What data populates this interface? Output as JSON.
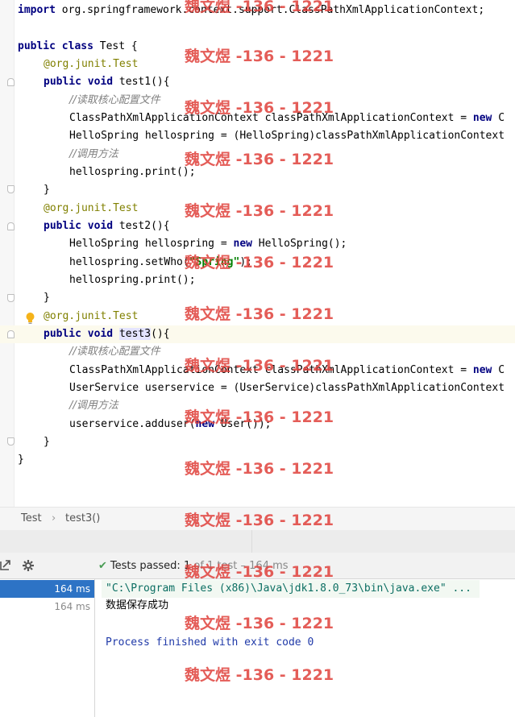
{
  "editor": {
    "lines": {
      "l0": [
        "import",
        " org.springframework.context.support.ClassPathXmlApplicationContext;"
      ],
      "l2": [
        "public",
        " ",
        "class",
        " Test {"
      ],
      "l3": "@org.junit.",
      "l3b": "Test",
      "l4": [
        "public",
        " ",
        "void",
        " test1(){"
      ],
      "l5": "//读取核心配置文件",
      "l6": [
        "ClassPathXmlApplicationContext classPathXmlApplicationContext = ",
        "new",
        " C"
      ],
      "l7": "HelloSpring hellospring = (HelloSpring)classPathXmlApplicationContext",
      "l8": "//调用方法",
      "l9": "hellospring.print();",
      "l10": "}",
      "l11": "@org.junit.",
      "l11b": "Test",
      "l12": [
        "public",
        " ",
        "void",
        " test2(){"
      ],
      "l13": [
        "HelloSpring hellospring = ",
        "new",
        " HelloSpring();"
      ],
      "l14": [
        "hellospring.setWho(",
        "\"Spring\"",
        ");"
      ],
      "l15": "hellospring.print();",
      "l16": "}",
      "l17": "@org.junit.",
      "l17b": "Test",
      "l18": [
        "public",
        " ",
        "void",
        " ",
        "test3",
        "(){"
      ],
      "l19": "//读取核心配置文件",
      "l20": [
        "ClassPathXmlApplicationContext classPathXmlApplicationContext = ",
        "new",
        " C"
      ],
      "l21": "UserService userservice = (UserService)classPathXmlApplicationContext",
      "l22": "//调用方法",
      "l23": [
        "userservice.adduser(",
        "new",
        " User());"
      ],
      "l24": "}",
      "l25": "}"
    }
  },
  "watermark": "魏文煜 -136 - 1221",
  "breadcrumb": {
    "class_name": "Test",
    "separator": "›",
    "method_name": "test3()"
  },
  "run": {
    "status_check": "✔",
    "status_text": "Tests passed: 1",
    "status_suffix": "of 1 test – 164 ms",
    "tree": [
      {
        "time": "164 ms"
      },
      {
        "time": "164 ms"
      }
    ],
    "console": {
      "command": "\"C:\\Program Files (x86)\\Java\\jdk1.8.0_73\\bin\\java.exe\" ...",
      "output": "数据保存成功",
      "exit": "Process finished with exit code 0"
    }
  },
  "colors": {
    "keyword": "#000080",
    "annotation": "#808000",
    "comment": "#808080",
    "string": "#008000",
    "selection": "#2d73c5",
    "watermark": "#e0413c"
  }
}
